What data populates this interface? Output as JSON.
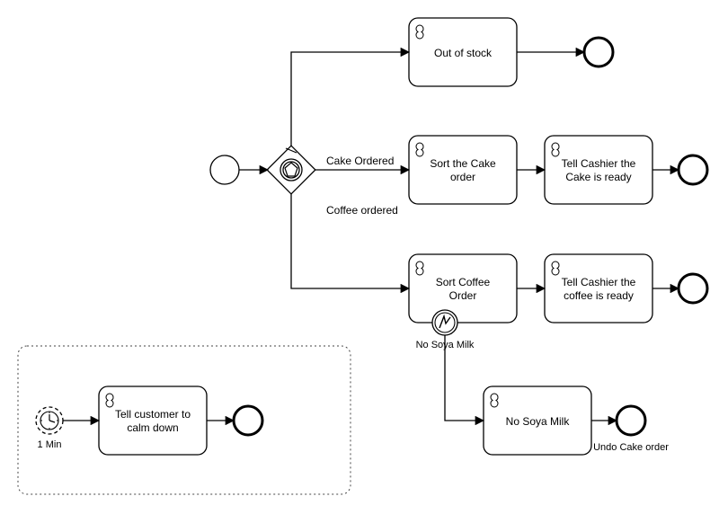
{
  "tasks": {
    "outOfStock": "Out of stock",
    "sortCake": "Sort the Cake order",
    "tellCake": "Tell Cashier the Cake is ready",
    "sortCoffee": "Sort Coffee Order",
    "tellCoffee": "Tell Cashier the coffee is ready",
    "noSoyaMilkTask": "No Soya Milk",
    "calmDown": "Tell customer to calm down"
  },
  "labels": {
    "cakeOrdered": "Cake Ordered",
    "coffeeOrdered": "Coffee ordered",
    "noSoyaMilk": "No Soya Milk",
    "undoCake": "Undo Cake order",
    "oneMin": "1 Min"
  }
}
